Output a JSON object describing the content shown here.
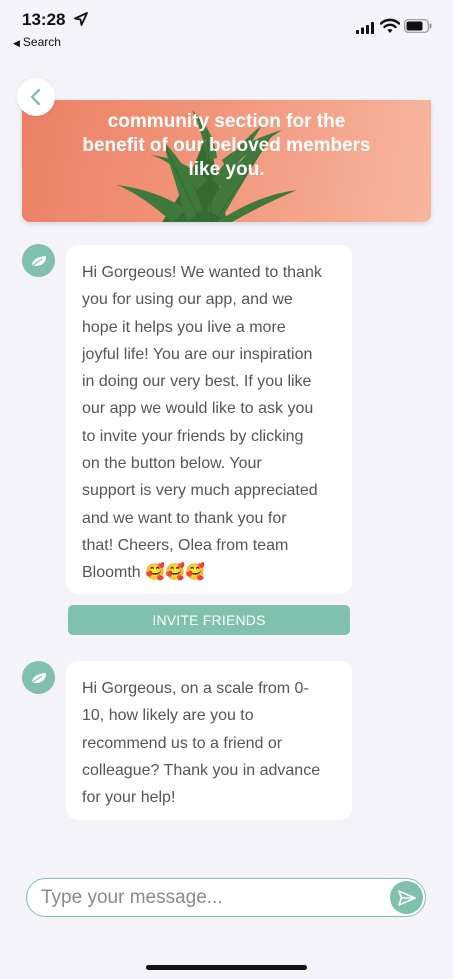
{
  "status_bar": {
    "time": "13:28",
    "back_app": "Search",
    "icons": [
      "location-arrow-icon",
      "cellular-signal-icon",
      "wifi-icon",
      "battery-icon"
    ]
  },
  "nav": {
    "back_icon": "chevron-left-icon"
  },
  "banner": {
    "lines": [
      "community section for the",
      "benefit of our beloved members",
      "like you."
    ]
  },
  "messages": [
    {
      "avatar_icon": "leaf-icon",
      "lines": [
        "Hi Gorgeous! We wanted to thank",
        "you for using our app, and we",
        "hope it helps you live a more",
        "joyful life! You are our inspiration",
        "in doing our very best. If you like",
        "our app we would like to ask you",
        "to invite your friends by clicking",
        "on the button below. Your",
        "support is very much appreciated",
        "and we want to thank you for",
        "that! Cheers, Olea from team",
        "Bloomth 🥰🥰🥰"
      ],
      "button_label": "INVITE FRIENDS"
    },
    {
      "avatar_icon": "leaf-icon",
      "lines": [
        "Hi Gorgeous, on a scale from 0-",
        "10, how likely are you to",
        "recommend us to a friend or",
        "colleague? Thank you in advance",
        "for your help!"
      ]
    }
  ],
  "composer": {
    "placeholder": "Type your message...",
    "value": "",
    "send_icon": "send-icon"
  },
  "colors": {
    "accent": "#7fc1ad",
    "background": "#f3f3f9",
    "banner": "#ef8a70"
  }
}
